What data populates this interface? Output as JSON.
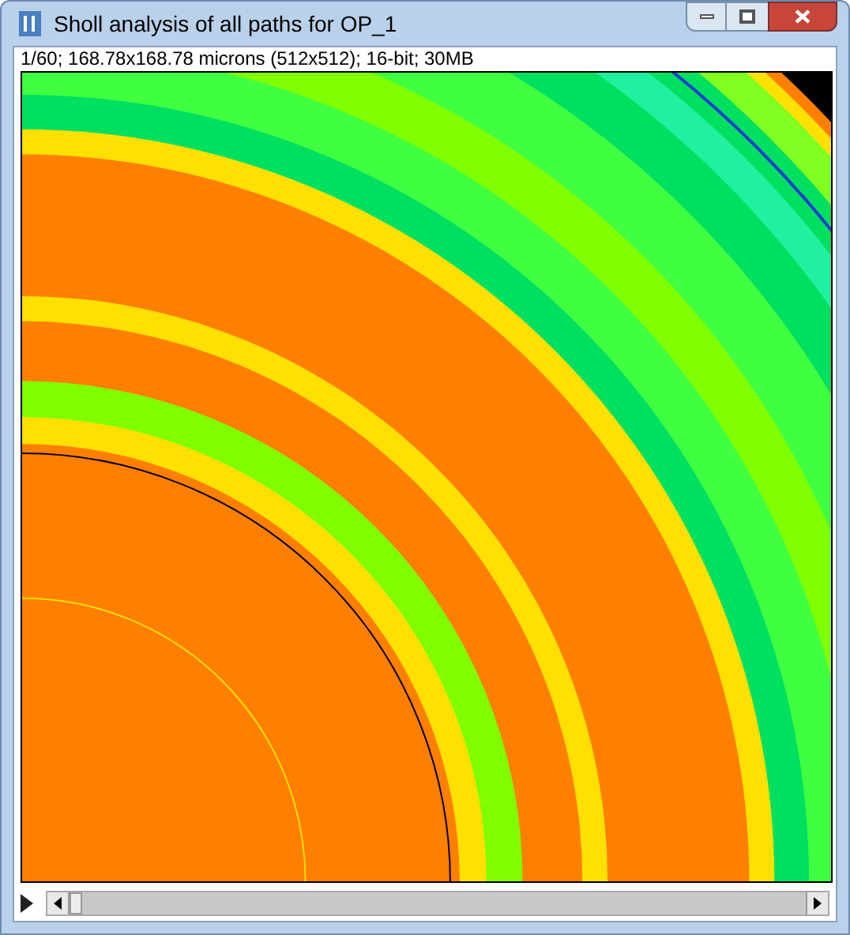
{
  "window": {
    "title": "Sholl analysis of all paths for OP_1"
  },
  "image_info": "1/60; 168.78x168.78 microns (512x512); 16-bit; 30MB",
  "slice_scrollbar": {
    "level": 0
  }
}
